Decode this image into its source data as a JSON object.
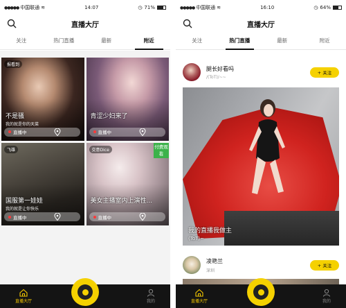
{
  "left": {
    "status": {
      "carrier": "中国联通",
      "time": "14:07",
      "battery": "71%"
    },
    "title": "直播大厅",
    "tabs": [
      "关注",
      "热门直播",
      "最新",
      "附近"
    ],
    "active_tab": "附近",
    "tiles": [
      {
        "tag": "报看到",
        "caption": "不是骚",
        "sub": "我的就是你的天菜",
        "live": "直播中"
      },
      {
        "tag": "",
        "caption": "青涩少妇来了",
        "sub": "",
        "live": "直播中"
      },
      {
        "tag": "飞雄",
        "caption": "国服第一娃娃",
        "sub": "我的就是让你快乐",
        "live": "直播中"
      },
      {
        "tag": "交意Dice",
        "caption": "美女主播室内上演性...",
        "sub": "",
        "live": "直播中",
        "paid": "付费观看"
      }
    ],
    "nav": {
      "left": "直播大厅",
      "right": "我的"
    }
  },
  "right": {
    "status": {
      "carrier": "中国联通",
      "time": "16:10",
      "battery": "64%"
    },
    "title": "直播大厅",
    "tabs": [
      "关注",
      "热门直播",
      "最新",
      "附近"
    ],
    "active_tab": "热门直播",
    "card1": {
      "name": "腿长好看吗",
      "sub": "/(ToT)/~~",
      "follow": "+ 关注",
      "caption": "我的直播我做主",
      "caption_sub": "(ToT)~"
    },
    "card2": {
      "name": "凌艳兰",
      "sub": "深圳",
      "follow": "+ 关注"
    },
    "nav": {
      "left": "直播大厅",
      "right": "我的"
    }
  },
  "colors": {
    "accent": "#f5d100",
    "nav_bg": "#141414",
    "paid": "#3cb24a",
    "live_dot": "#ff3a3a"
  }
}
